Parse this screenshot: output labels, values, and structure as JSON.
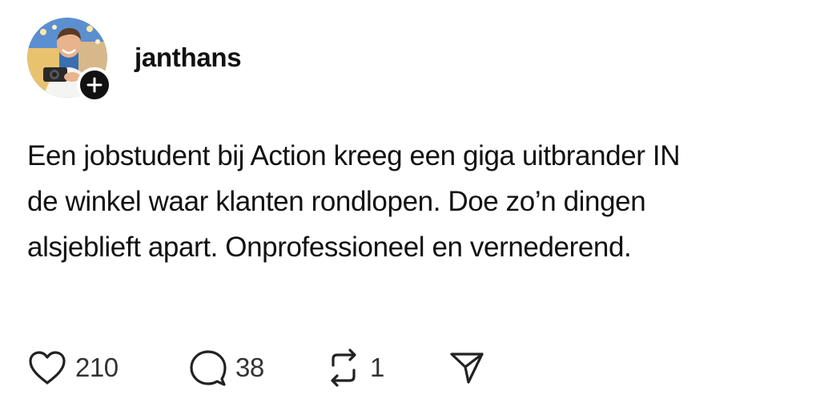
{
  "post": {
    "username": "janthans",
    "text_lines": [
      "Een jobstudent bij Action kreeg een giga uitbrander IN",
      "de winkel waar klanten rondlopen. Doe zo’n dingen",
      "alsjeblieft apart. Onprofessioneel en vernederend."
    ],
    "actions": {
      "likes": "210",
      "replies": "38",
      "reposts": "1"
    }
  },
  "icons": {
    "like": "heart-icon",
    "reply": "speech-bubble-icon",
    "repost": "repost-icon",
    "share": "paper-plane-icon",
    "follow": "plus-icon"
  },
  "colors": {
    "text": "#111111",
    "icon": "#222222",
    "badge": "#111111",
    "background": "#ffffff"
  }
}
